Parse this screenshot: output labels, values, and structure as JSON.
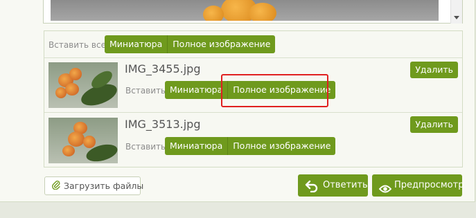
{
  "insert_all": {
    "label": "Вставить все:",
    "thumbnail_label": "Миниатюра",
    "full_label": "Полное изображение"
  },
  "attachments": [
    {
      "filename": "IMG_3455.jpg",
      "insert_label": "Вставить:",
      "thumbnail_label": "Миниатюра",
      "full_label": "Полное изображение",
      "delete_label": "Удалить"
    },
    {
      "filename": "IMG_3513.jpg",
      "insert_label": "Вставить:",
      "thumbnail_label": "Миниатюра",
      "full_label": "Полное изображение",
      "delete_label": "Удалить"
    }
  ],
  "footer": {
    "upload_label": "Загрузить файлы",
    "upload_icon": "paperclip-icon",
    "reply_label": "Ответить",
    "reply_icon": "reply-arrow-icon",
    "preview_label": "Предпросмотр",
    "preview_icon": "eye-icon"
  },
  "colors": {
    "button_green": "#6f9a1d",
    "highlight_red": "#e02020"
  }
}
